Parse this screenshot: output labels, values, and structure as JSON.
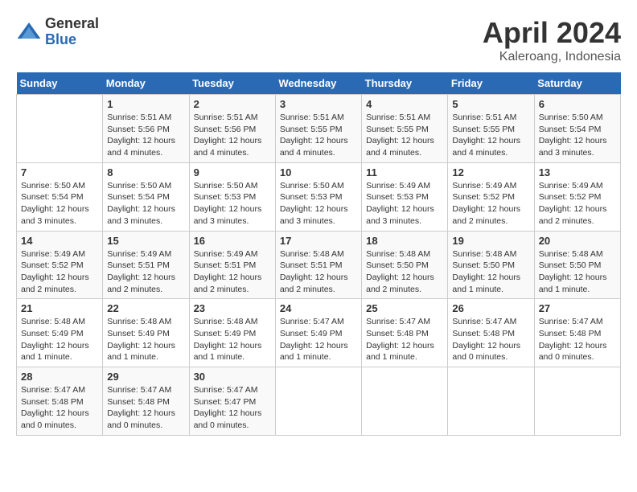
{
  "header": {
    "logo_general": "General",
    "logo_blue": "Blue",
    "month_title": "April 2024",
    "location": "Kaleroang, Indonesia"
  },
  "weekdays": [
    "Sunday",
    "Monday",
    "Tuesday",
    "Wednesday",
    "Thursday",
    "Friday",
    "Saturday"
  ],
  "weeks": [
    [
      {
        "day": "",
        "info": ""
      },
      {
        "day": "1",
        "info": "Sunrise: 5:51 AM\nSunset: 5:56 PM\nDaylight: 12 hours\nand 4 minutes."
      },
      {
        "day": "2",
        "info": "Sunrise: 5:51 AM\nSunset: 5:56 PM\nDaylight: 12 hours\nand 4 minutes."
      },
      {
        "day": "3",
        "info": "Sunrise: 5:51 AM\nSunset: 5:55 PM\nDaylight: 12 hours\nand 4 minutes."
      },
      {
        "day": "4",
        "info": "Sunrise: 5:51 AM\nSunset: 5:55 PM\nDaylight: 12 hours\nand 4 minutes."
      },
      {
        "day": "5",
        "info": "Sunrise: 5:51 AM\nSunset: 5:55 PM\nDaylight: 12 hours\nand 4 minutes."
      },
      {
        "day": "6",
        "info": "Sunrise: 5:50 AM\nSunset: 5:54 PM\nDaylight: 12 hours\nand 3 minutes."
      }
    ],
    [
      {
        "day": "7",
        "info": "Sunrise: 5:50 AM\nSunset: 5:54 PM\nDaylight: 12 hours\nand 3 minutes."
      },
      {
        "day": "8",
        "info": "Sunrise: 5:50 AM\nSunset: 5:54 PM\nDaylight: 12 hours\nand 3 minutes."
      },
      {
        "day": "9",
        "info": "Sunrise: 5:50 AM\nSunset: 5:53 PM\nDaylight: 12 hours\nand 3 minutes."
      },
      {
        "day": "10",
        "info": "Sunrise: 5:50 AM\nSunset: 5:53 PM\nDaylight: 12 hours\nand 3 minutes."
      },
      {
        "day": "11",
        "info": "Sunrise: 5:49 AM\nSunset: 5:53 PM\nDaylight: 12 hours\nand 3 minutes."
      },
      {
        "day": "12",
        "info": "Sunrise: 5:49 AM\nSunset: 5:52 PM\nDaylight: 12 hours\nand 2 minutes."
      },
      {
        "day": "13",
        "info": "Sunrise: 5:49 AM\nSunset: 5:52 PM\nDaylight: 12 hours\nand 2 minutes."
      }
    ],
    [
      {
        "day": "14",
        "info": "Sunrise: 5:49 AM\nSunset: 5:52 PM\nDaylight: 12 hours\nand 2 minutes."
      },
      {
        "day": "15",
        "info": "Sunrise: 5:49 AM\nSunset: 5:51 PM\nDaylight: 12 hours\nand 2 minutes."
      },
      {
        "day": "16",
        "info": "Sunrise: 5:49 AM\nSunset: 5:51 PM\nDaylight: 12 hours\nand 2 minutes."
      },
      {
        "day": "17",
        "info": "Sunrise: 5:48 AM\nSunset: 5:51 PM\nDaylight: 12 hours\nand 2 minutes."
      },
      {
        "day": "18",
        "info": "Sunrise: 5:48 AM\nSunset: 5:50 PM\nDaylight: 12 hours\nand 2 minutes."
      },
      {
        "day": "19",
        "info": "Sunrise: 5:48 AM\nSunset: 5:50 PM\nDaylight: 12 hours\nand 1 minute."
      },
      {
        "day": "20",
        "info": "Sunrise: 5:48 AM\nSunset: 5:50 PM\nDaylight: 12 hours\nand 1 minute."
      }
    ],
    [
      {
        "day": "21",
        "info": "Sunrise: 5:48 AM\nSunset: 5:49 PM\nDaylight: 12 hours\nand 1 minute."
      },
      {
        "day": "22",
        "info": "Sunrise: 5:48 AM\nSunset: 5:49 PM\nDaylight: 12 hours\nand 1 minute."
      },
      {
        "day": "23",
        "info": "Sunrise: 5:48 AM\nSunset: 5:49 PM\nDaylight: 12 hours\nand 1 minute."
      },
      {
        "day": "24",
        "info": "Sunrise: 5:47 AM\nSunset: 5:49 PM\nDaylight: 12 hours\nand 1 minute."
      },
      {
        "day": "25",
        "info": "Sunrise: 5:47 AM\nSunset: 5:48 PM\nDaylight: 12 hours\nand 1 minute."
      },
      {
        "day": "26",
        "info": "Sunrise: 5:47 AM\nSunset: 5:48 PM\nDaylight: 12 hours\nand 0 minutes."
      },
      {
        "day": "27",
        "info": "Sunrise: 5:47 AM\nSunset: 5:48 PM\nDaylight: 12 hours\nand 0 minutes."
      }
    ],
    [
      {
        "day": "28",
        "info": "Sunrise: 5:47 AM\nSunset: 5:48 PM\nDaylight: 12 hours\nand 0 minutes."
      },
      {
        "day": "29",
        "info": "Sunrise: 5:47 AM\nSunset: 5:48 PM\nDaylight: 12 hours\nand 0 minutes."
      },
      {
        "day": "30",
        "info": "Sunrise: 5:47 AM\nSunset: 5:47 PM\nDaylight: 12 hours\nand 0 minutes."
      },
      {
        "day": "",
        "info": ""
      },
      {
        "day": "",
        "info": ""
      },
      {
        "day": "",
        "info": ""
      },
      {
        "day": "",
        "info": ""
      }
    ]
  ]
}
